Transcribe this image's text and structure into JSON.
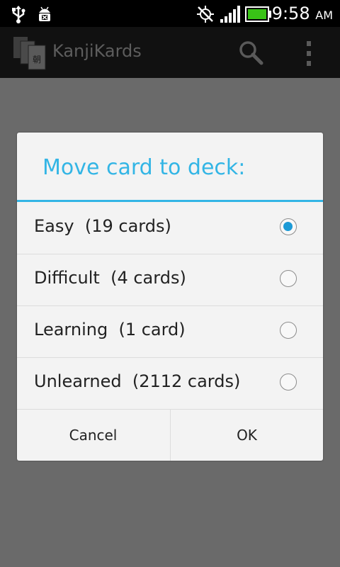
{
  "status_bar": {
    "time": "9:58",
    "ampm": "AM",
    "icons": [
      "usb-icon",
      "android-debug-icon",
      "gps-off-icon",
      "signal-icon",
      "battery-icon"
    ]
  },
  "action_bar": {
    "app_title": "KanjiKards",
    "logo_glyph": "朝",
    "icons": [
      "search-icon",
      "overflow-menu-icon"
    ]
  },
  "dialog": {
    "title": "Move card to deck:",
    "accent_color": "#33b5e5",
    "options": [
      {
        "label": "Easy  (19 cards)",
        "checked": true
      },
      {
        "label": "Difficult  (4 cards)",
        "checked": false
      },
      {
        "label": "Learning  (1 card)",
        "checked": false
      },
      {
        "label": "Unlearned  (2112 cards)",
        "checked": false
      }
    ],
    "cancel_label": "Cancel",
    "ok_label": "OK"
  }
}
